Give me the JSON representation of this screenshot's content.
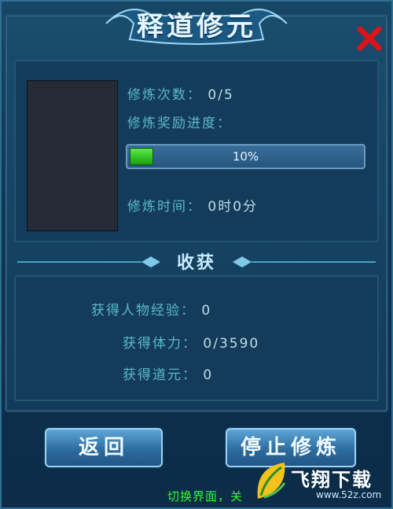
{
  "window": {
    "title": "释道修元",
    "close_icon": "close-x-icon"
  },
  "training": {
    "count_label": "修炼次数：",
    "count_value": "0/5",
    "reward_label": "修炼奖励进度：",
    "progress_percent": 10,
    "progress_text": "10%",
    "time_label": "修炼时间：",
    "time_value": "0时0分"
  },
  "harvest": {
    "section_title": "收获",
    "exp_label": "获得人物经验：",
    "exp_value": "0",
    "stamina_label": "获得体力：",
    "stamina_value": "0/3590",
    "daoyuan_label": "获得道元：",
    "daoyuan_value": "0"
  },
  "buttons": {
    "back": "返回",
    "stop": "停止修炼"
  },
  "footer": {
    "note": "切换界面，关"
  },
  "watermark": {
    "brand": "飞翔下载",
    "url": "www.52z.com"
  },
  "colors": {
    "label": "#5ab8c9",
    "progress_fill": "#17a20d",
    "close_x": "#d9141a"
  }
}
